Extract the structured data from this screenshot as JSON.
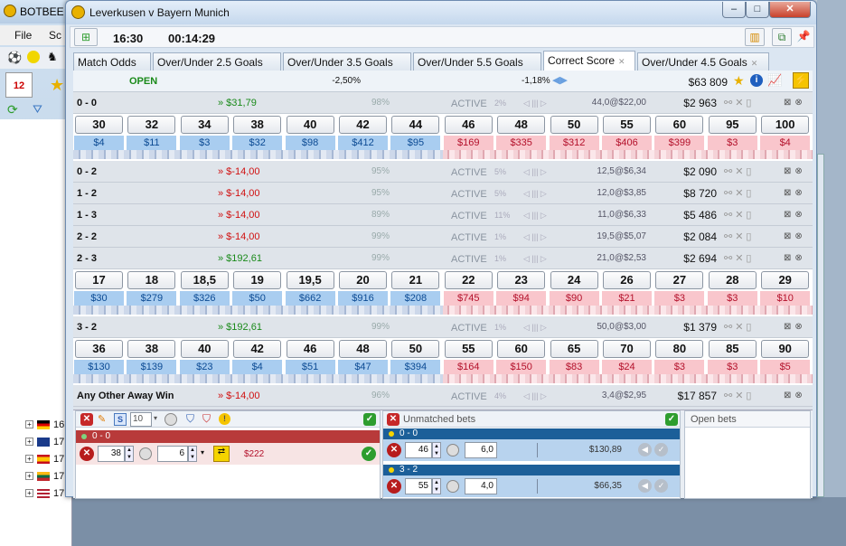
{
  "background_app": {
    "title": "BOTBEE",
    "menu": [
      "File",
      "Sc"
    ],
    "tree_counts": [
      "16",
      "17",
      "17",
      "17",
      "17"
    ]
  },
  "window": {
    "title": "Leverkusen v Bayern Munich",
    "controls": {
      "minimize": "–",
      "maximize": "□",
      "close": "✕"
    }
  },
  "toolbar": {
    "time": "16:30",
    "countdown": "00:14:29"
  },
  "tabs": [
    {
      "label": "Match Odds",
      "active": false
    },
    {
      "label": "Over/Under 2.5 Goals",
      "active": false
    },
    {
      "label": "Over/Under 3.5 Goals",
      "active": false
    },
    {
      "label": "Over/Under 5.5 Goals",
      "active": false
    },
    {
      "label": "Correct Score",
      "active": true
    },
    {
      "label": "Over/Under 4.5 Goals",
      "active": false
    }
  ],
  "market_header": {
    "status": "OPEN",
    "back_book_pct": "-2,50%",
    "lay_book_pct": "-1,18%",
    "total_matched": "$63 809"
  },
  "runners": [
    {
      "name": "0 - 0",
      "pl": "» $31,79",
      "pl_sign": "pos",
      "pct": "98%",
      "status": "ACTIVE",
      "pct2": "2%",
      "count": "44,0@$22,00",
      "matched": "$2 963",
      "ladder": {
        "odds": [
          "30",
          "32",
          "34",
          "38",
          "40",
          "42",
          "44",
          "46",
          "48",
          "50",
          "55",
          "60",
          "95",
          "100"
        ],
        "amounts": [
          "$4",
          "$11",
          "$3",
          "$32",
          "$98",
          "$412",
          "$95",
          "$169",
          "$335",
          "$312",
          "$406",
          "$399",
          "$3",
          "$4"
        ]
      }
    },
    {
      "name": "0 - 2",
      "pl": "» $-14,00",
      "pl_sign": "neg",
      "pct": "95%",
      "status": "ACTIVE",
      "pct2": "5%",
      "count": "12,5@$6,34",
      "matched": "$2 090"
    },
    {
      "name": "1 - 2",
      "pl": "» $-14,00",
      "pl_sign": "neg",
      "pct": "95%",
      "status": "ACTIVE",
      "pct2": "5%",
      "count": "12,0@$3,85",
      "matched": "$8 720"
    },
    {
      "name": "1 - 3",
      "pl": "» $-14,00",
      "pl_sign": "neg",
      "pct": "89%",
      "status": "ACTIVE",
      "pct2": "11%",
      "count": "11,0@$6,33",
      "matched": "$5 486"
    },
    {
      "name": "2 - 2",
      "pl": "» $-14,00",
      "pl_sign": "neg",
      "pct": "99%",
      "status": "ACTIVE",
      "pct2": "1%",
      "count": "19,5@$5,07",
      "matched": "$2 084"
    },
    {
      "name": "2 - 3",
      "pl": "» $192,61",
      "pl_sign": "pos",
      "pct": "99%",
      "status": "ACTIVE",
      "pct2": "1%",
      "count": "21,0@$2,53",
      "matched": "$2 694",
      "ladder": {
        "odds": [
          "17",
          "18",
          "18,5",
          "19",
          "19,5",
          "20",
          "21",
          "22",
          "23",
          "24",
          "26",
          "27",
          "28",
          "29"
        ],
        "amounts": [
          "$30",
          "$279",
          "$326",
          "$50",
          "$662",
          "$916",
          "$208",
          "$745",
          "$94",
          "$90",
          "$21",
          "$3",
          "$3",
          "$10"
        ]
      }
    },
    {
      "name": "3 - 2",
      "pl": "» $192,61",
      "pl_sign": "pos",
      "pct": "99%",
      "status": "ACTIVE",
      "pct2": "1%",
      "count": "50,0@$3,00",
      "matched": "$1 379",
      "ladder": {
        "odds": [
          "36",
          "38",
          "40",
          "42",
          "46",
          "48",
          "50",
          "55",
          "60",
          "65",
          "70",
          "80",
          "85",
          "90"
        ],
        "amounts": [
          "$130",
          "$139",
          "$23",
          "$4",
          "$51",
          "$47",
          "$394",
          "$164",
          "$150",
          "$83",
          "$24",
          "$3",
          "$3",
          "$5"
        ]
      }
    },
    {
      "name": "Any Other Away Win",
      "pl": "» $-14,00",
      "pl_sign": "neg",
      "pct": "96%",
      "status": "ACTIVE",
      "pct2": "4%",
      "count": "3,4@$2,95",
      "matched": "$17 857"
    }
  ],
  "betslip": {
    "stake_selector": "10",
    "selection": "0 - 0",
    "odds": "38",
    "stake": "6",
    "liability": "$222"
  },
  "unmatched": {
    "title": "Unmatched bets",
    "bets": [
      {
        "selection": "0 - 0",
        "odds": "46",
        "price": "6,0",
        "value": "$130,89"
      },
      {
        "selection": "3 - 2",
        "odds": "55",
        "price": "4,0",
        "value": "$66,35"
      }
    ]
  },
  "open_bets": {
    "title": "Open bets"
  }
}
